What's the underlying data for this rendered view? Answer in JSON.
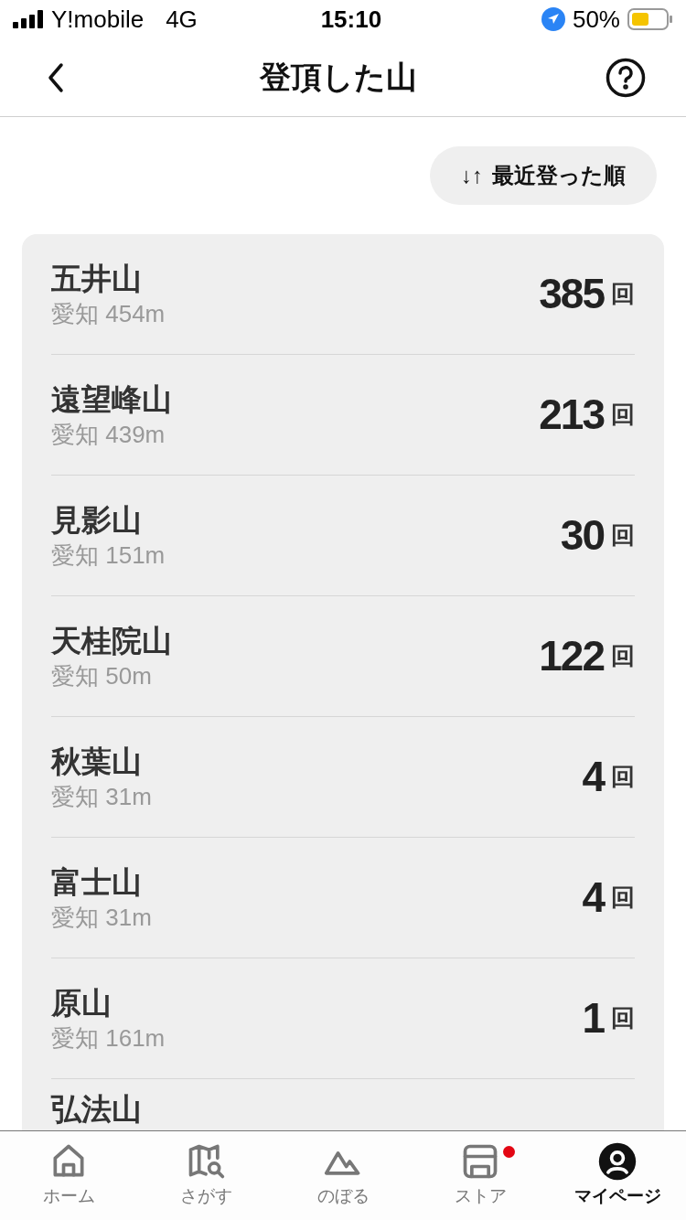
{
  "status_bar": {
    "carrier": "Y!mobile",
    "network": "4G",
    "time": "15:10",
    "battery": "50%"
  },
  "header": {
    "title": "登頂した山"
  },
  "sort_button": {
    "icon_text": "↓↑",
    "label": "最近登った順"
  },
  "mountains": [
    {
      "name": "五井山",
      "sub": "愛知 454m",
      "count": "385",
      "unit": "回"
    },
    {
      "name": "遠望峰山",
      "sub": "愛知 439m",
      "count": "213",
      "unit": "回"
    },
    {
      "name": "見影山",
      "sub": "愛知 151m",
      "count": "30",
      "unit": "回"
    },
    {
      "name": "天桂院山",
      "sub": "愛知 50m",
      "count": "122",
      "unit": "回"
    },
    {
      "name": "秋葉山",
      "sub": "愛知 31m",
      "count": "4",
      "unit": "回"
    },
    {
      "name": "富士山",
      "sub": "愛知 31m",
      "count": "4",
      "unit": "回"
    },
    {
      "name": "原山",
      "sub": "愛知 161m",
      "count": "1",
      "unit": "回"
    },
    {
      "name": "弘法山"
    }
  ],
  "tab_bar": [
    {
      "kind": "home",
      "label": "ホーム",
      "selected": false,
      "badge": false
    },
    {
      "kind": "map",
      "label": "さがす",
      "selected": false,
      "badge": false
    },
    {
      "kind": "mountain",
      "label": "のぼる",
      "selected": false,
      "badge": false
    },
    {
      "kind": "store",
      "label": "ストア",
      "selected": false,
      "badge": true
    },
    {
      "kind": "user",
      "label": "マイページ",
      "selected": true,
      "badge": false
    }
  ]
}
